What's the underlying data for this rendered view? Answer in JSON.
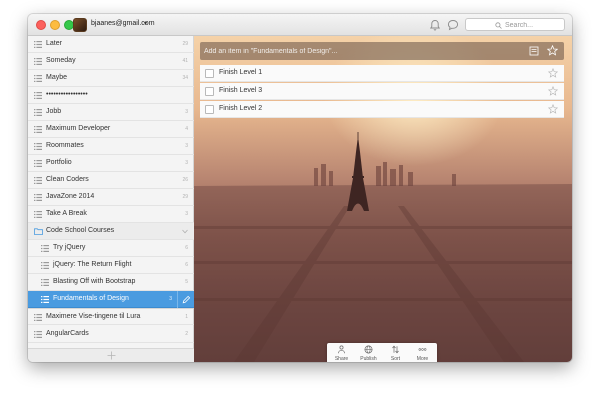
{
  "titlebar": {
    "user_email": "bjaanes@gmail.com",
    "caret": "▾",
    "search_placeholder": "Search..."
  },
  "sidebar": {
    "items": [
      {
        "label": "Later",
        "count": "29"
      },
      {
        "label": "Someday",
        "count": "41"
      },
      {
        "label": "Maybe",
        "count": "34"
      },
      {
        "label": "•••••••••••••••••",
        "count": ""
      },
      {
        "label": "Jobb",
        "count": "3"
      },
      {
        "label": "Maximum Developer",
        "count": "4"
      },
      {
        "label": "Roommates",
        "count": "3"
      },
      {
        "label": "Portfolio",
        "count": "3"
      },
      {
        "label": "Clean Coders",
        "count": "26"
      },
      {
        "label": "JavaZone 2014",
        "count": "29"
      },
      {
        "label": "Take A Break",
        "count": "3"
      }
    ],
    "folder": {
      "label": "Code School Courses"
    },
    "folder_items": [
      {
        "label": "Try jQuery",
        "count": "6"
      },
      {
        "label": "jQuery: The Return Flight",
        "count": "6"
      },
      {
        "label": "Blasting Off with Bootstrap",
        "count": "5"
      },
      {
        "label": "Fundamentals of Design",
        "count": "3"
      }
    ],
    "after_items": [
      {
        "label": "Maximere Vise-tingene til Lura",
        "count": "1"
      },
      {
        "label": "AngularCards",
        "count": "2"
      }
    ]
  },
  "main": {
    "add_placeholder": "Add an item in \"Fundamentals of Design\"...",
    "tasks": [
      {
        "title": "Finish Level 1"
      },
      {
        "title": "Finish Level 3"
      },
      {
        "title": "Finish Level 2"
      }
    ],
    "toolbar": [
      {
        "label": "Share",
        "icon": "share-icon"
      },
      {
        "label": "Publish",
        "icon": "publish-icon"
      },
      {
        "label": "Sort",
        "icon": "sort-icon"
      },
      {
        "label": "More",
        "icon": "more-icon"
      }
    ]
  },
  "colors": {
    "accent": "#4a9be0",
    "traffic_close": "#fc605c",
    "traffic_min": "#fdbc40",
    "traffic_max": "#34c84a"
  }
}
